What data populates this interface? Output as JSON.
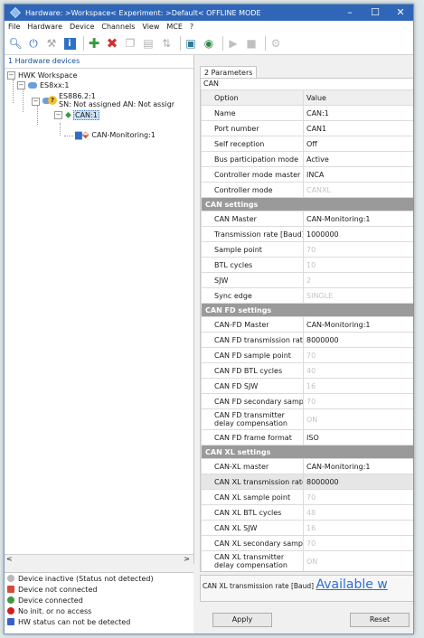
{
  "window": {
    "title": "Hardware: >Workspace< Experiment: >Default< OFFLINE MODE",
    "min": "–",
    "max": "☐",
    "close": "✕"
  },
  "menu": [
    "File",
    "Hardware",
    "Device",
    "Channels",
    "View",
    "MCE",
    "?"
  ],
  "tree": {
    "header": "1 Hardware devices",
    "workspace": "HWK Workspace",
    "es8xx": "ES8xx:1",
    "es886": "ES886.2:1",
    "sn": "SN: Not assigned AN: Not assigr",
    "can1": "CAN:1",
    "canmon": "CAN-Monitoring:1"
  },
  "legend": [
    {
      "label": "Device inactive (Status not detected)",
      "color": "#b8b8b8"
    },
    {
      "label": "Device not connected",
      "color": "#d54b3b"
    },
    {
      "label": "Device connected",
      "color": "#3f9a3f"
    },
    {
      "label": "No init. or no access",
      "color": "#d21f1f"
    },
    {
      "label": "HW status can not be detected",
      "color": "#3a5fc8"
    }
  ],
  "params": {
    "tab": "2 Parameters",
    "section": "CAN",
    "col_option": "Option",
    "col_value": "Value",
    "rows": [
      {
        "o": "Name",
        "v": "CAN:1"
      },
      {
        "o": "Port number",
        "v": "CAN1"
      },
      {
        "o": "Self reception",
        "v": "Off"
      },
      {
        "o": "Bus participation mode",
        "v": "Active"
      },
      {
        "o": "Controller mode master",
        "v": "INCA"
      },
      {
        "o": "Controller mode",
        "v": "CANXL"
      }
    ],
    "can_settings": "CAN settings",
    "can_rows": [
      {
        "o": "CAN Master",
        "v": "CAN-Monitoring:1"
      },
      {
        "o": "Transmission rate [Baud]",
        "v": "1000000"
      },
      {
        "o": "Sample point",
        "v": "70"
      },
      {
        "o": "BTL cycles",
        "v": "10"
      },
      {
        "o": "SJW",
        "v": "2"
      },
      {
        "o": "Sync edge",
        "v": "SINGLE"
      }
    ],
    "canfd_settings": "CAN FD settings",
    "canfd_rows": [
      {
        "o": "CAN-FD Master",
        "v": "CAN-Monitoring:1"
      },
      {
        "o": "CAN FD transmission rate",
        "v": "8000000"
      },
      {
        "o": "CAN FD sample point",
        "v": "70"
      },
      {
        "o": "CAN FD BTL cycles",
        "v": "40"
      },
      {
        "o": "CAN FD SJW",
        "v": "16"
      },
      {
        "o": "CAN FD secondary samp",
        "v": "70"
      },
      {
        "o": "CAN FD transmitter delay compensation",
        "v": "ON"
      },
      {
        "o": "CAN FD frame format",
        "v": "ISO"
      }
    ],
    "canxl_settings": "CAN XL settings",
    "canxl_rows": [
      {
        "o": "CAN-XL master",
        "v": "CAN-Monitoring:1"
      },
      {
        "o": "CAN XL transmission rate",
        "v": "8000000"
      },
      {
        "o": "CAN XL sample point",
        "v": "70"
      },
      {
        "o": "CAN XL BTL cycles",
        "v": "48"
      },
      {
        "o": "CAN XL SJW",
        "v": "16"
      },
      {
        "o": "CAN XL secondary sampl",
        "v": "70"
      },
      {
        "o": "CAN XL transmitter delay compensation",
        "v": "ON"
      }
    ],
    "desc_label": "CAN XL transmission rate [Baud]",
    "desc_big": "Available w",
    "apply": "Apply",
    "reset": "Reset"
  }
}
